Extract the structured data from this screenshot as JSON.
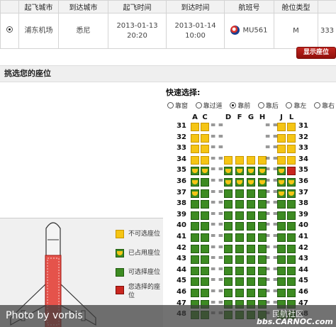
{
  "flight_table": {
    "headers": [
      "",
      "起飞城市",
      "到达城市",
      "起飞时间",
      "到达时间",
      "航班号",
      "舱位类型",
      ""
    ],
    "row": {
      "selected": true,
      "from": "浦东机场",
      "to": "悉尼",
      "dep_date": "2013-01-13",
      "dep_time": "20:20",
      "arr_date": "2013-01-14",
      "arr_time": "10:00",
      "flight_no": "MU561",
      "cabin": "M",
      "extra": "333",
      "airline_icon": "china-eastern-logo-icon"
    }
  },
  "show_seat_button": "显示座位",
  "section_title": "挑选您的座位",
  "quick_select": {
    "title": "快速选择:",
    "options": [
      {
        "label": "靠窗",
        "checked": false
      },
      {
        "label": "靠过道",
        "checked": false
      },
      {
        "label": "靠前",
        "checked": true
      },
      {
        "label": "靠后",
        "checked": false
      },
      {
        "label": "靠左",
        "checked": false
      },
      {
        "label": "靠右",
        "checked": false
      }
    ]
  },
  "columns": [
    "A",
    "C",
    "D",
    "F",
    "G",
    "H",
    "J",
    "L"
  ],
  "rows": [
    {
      "num": "31",
      "seats": [
        "unavailable",
        "unavailable",
        null,
        null,
        null,
        null,
        "unavailable",
        "unavailable"
      ]
    },
    {
      "num": "32",
      "seats": [
        "unavailable",
        "unavailable",
        null,
        null,
        null,
        null,
        "unavailable",
        "unavailable"
      ]
    },
    {
      "num": "33",
      "seats": [
        "unavailable",
        "unavailable",
        null,
        null,
        null,
        null,
        "unavailable",
        "unavailable"
      ]
    },
    {
      "num": "34",
      "seats": [
        "unavailable",
        "unavailable",
        "unavailable",
        "unavailable",
        "unavailable",
        "unavailable",
        "unavailable",
        "unavailable"
      ]
    },
    {
      "num": "35",
      "seats": [
        "occupied",
        "occupied",
        "occupied",
        "occupied",
        "occupied",
        "occupied",
        "occupied",
        "selected"
      ]
    },
    {
      "num": "36",
      "seats": [
        "occupied",
        "available",
        "occupied",
        "occupied",
        "occupied",
        "occupied",
        "occupied",
        "occupied"
      ]
    },
    {
      "num": "37",
      "seats": [
        "occupied",
        "available",
        "available",
        "available",
        "available",
        "available",
        "occupied",
        "occupied"
      ]
    },
    {
      "num": "38",
      "seats": [
        "available",
        "available",
        "available",
        "available",
        "available",
        "available",
        "available",
        "available"
      ]
    },
    {
      "num": "39",
      "seats": [
        "available",
        "available",
        "available",
        "available",
        "available",
        "available",
        "available",
        "available"
      ]
    },
    {
      "num": "40",
      "seats": [
        "available",
        "available",
        "available",
        "available",
        "available",
        "available",
        "available",
        "available"
      ]
    },
    {
      "num": "41",
      "seats": [
        "available",
        "available",
        "available",
        "available",
        "available",
        "available",
        "available",
        "available"
      ]
    },
    {
      "num": "42",
      "seats": [
        "available",
        "available",
        "available",
        "available",
        "available",
        "available",
        "available",
        "available"
      ]
    },
    {
      "num": "43",
      "seats": [
        "available",
        "available",
        "available",
        "available",
        "available",
        "available",
        "available",
        "available"
      ]
    },
    {
      "num": "44",
      "seats": [
        "available",
        "available",
        "available",
        "available",
        "available",
        "available",
        "available",
        "available"
      ]
    },
    {
      "num": "45",
      "seats": [
        "available",
        "available",
        "available",
        "available",
        "available",
        "available",
        "available",
        "available"
      ]
    },
    {
      "num": "46",
      "seats": [
        "available",
        "available",
        "available",
        "available",
        "available",
        "available",
        "available",
        "available"
      ]
    },
    {
      "num": "47",
      "seats": [
        "available",
        "available",
        "available",
        "available",
        "available",
        "available",
        "available",
        "available"
      ]
    },
    {
      "num": "48",
      "seats": [
        "available",
        "available",
        "available",
        "available",
        "available",
        "available",
        "available",
        "available"
      ]
    }
  ],
  "gap_marker": "= =",
  "legend": [
    {
      "type": "unavailable",
      "label": "不可选座位"
    },
    {
      "type": "occupied",
      "label": "已占用座位"
    },
    {
      "type": "available",
      "label": "可选择座位"
    },
    {
      "type": "selected",
      "label": "您选择的座位"
    }
  ],
  "colors": {
    "available": "#3d8b22",
    "unavailable": "#f5c514",
    "selected": "#c9261f",
    "button": "#b01a14"
  },
  "watermark": {
    "credit": "Photo by vorbis",
    "cn": "民航社区",
    "site": "bbs.CARNOC.com"
  }
}
